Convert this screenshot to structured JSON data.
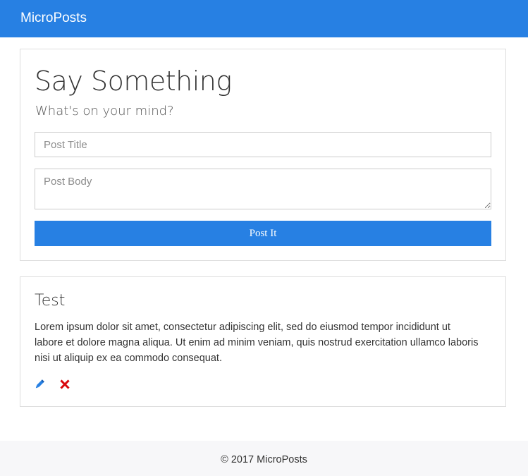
{
  "navbar": {
    "brand": "MicroPosts",
    "background_color": "#2780e3"
  },
  "form": {
    "title": "Say Something",
    "subtitle": "What's on your mind?",
    "title_placeholder": "Post Title",
    "title_value": "",
    "body_placeholder": "Post Body",
    "body_value": "",
    "submit_label": "Post It"
  },
  "posts": [
    {
      "title": "Test",
      "body": "Lorem ipsum dolor sit amet, consectetur adipiscing elit, sed do eiusmod tempor incididunt ut labore et dolore magna aliqua. Ut enim ad minim veniam, quis nostrud exercitation ullamco laboris nisi ut aliquip ex ea commodo consequat.",
      "edit_icon": "pencil-icon",
      "delete_icon": "remove-x-icon",
      "edit_color": "#2780e3",
      "delete_color": "#d9070d"
    }
  ],
  "footer": {
    "text": "© 2017 MicroPosts"
  }
}
